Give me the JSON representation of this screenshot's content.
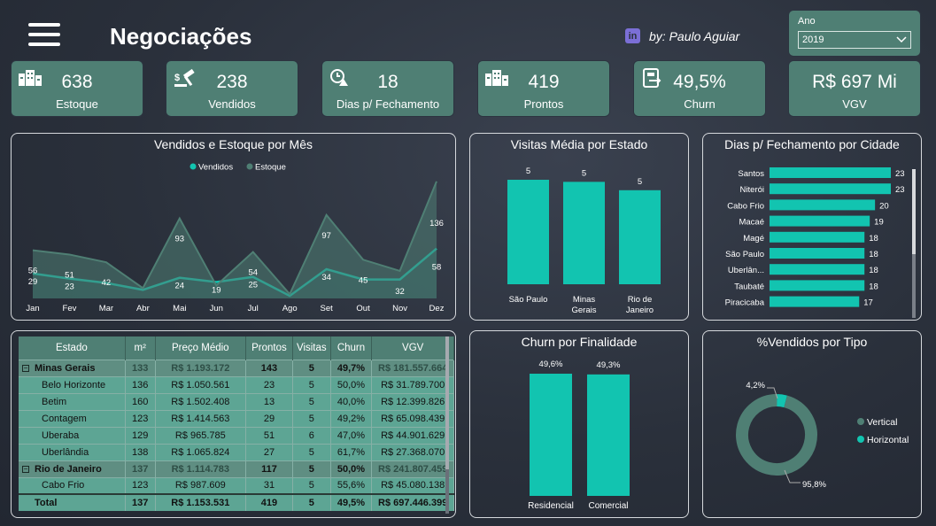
{
  "header": {
    "title": "Negociações",
    "author": "by: Paulo Aguiar",
    "linkedin_icon": "linkedin-icon",
    "filter_label": "Ano",
    "filter_value": "2019"
  },
  "colors": {
    "accent": "#12c4b0",
    "card": "#4f7f74",
    "estoque": "#4f7f74",
    "background": "#2a303b"
  },
  "kpis": [
    {
      "icon": "buildings-icon",
      "value": "638",
      "label": "Estoque"
    },
    {
      "icon": "auction-icon",
      "value": "238",
      "label": "Vendidos"
    },
    {
      "icon": "timer-icon",
      "value": "18",
      "label": "Dias p/ Fechamento"
    },
    {
      "icon": "buildings-icon",
      "value": "419",
      "label": "Prontos"
    },
    {
      "icon": "document-exit-icon",
      "value": "49,5%",
      "label": "Churn"
    },
    {
      "icon": "",
      "value": "R$ 697 Mi",
      "label": "VGV"
    }
  ],
  "chart_data": [
    {
      "type": "area",
      "title": "Vendidos e Estoque por Mês",
      "categories": [
        "Jan",
        "Fev",
        "Mar",
        "Abr",
        "Mai",
        "Jun",
        "Jul",
        "Ago",
        "Set",
        "Out",
        "Nov",
        "Dez"
      ],
      "series": [
        {
          "name": "Vendidos",
          "values": [
            29,
            23,
            18,
            10,
            24,
            19,
            25,
            3,
            34,
            22,
            22,
            58
          ],
          "labels": [
            "29",
            "23",
            "",
            "",
            "24",
            "19",
            "25",
            "",
            "34",
            "",
            "",
            "58"
          ]
        },
        {
          "name": "Estoque",
          "values": [
            56,
            51,
            42,
            12,
            93,
            15,
            54,
            5,
            97,
            45,
            32,
            136
          ],
          "labels": [
            "56",
            "51",
            "42",
            "",
            "93",
            "",
            "54",
            "",
            "97",
            "45",
            "32",
            "136"
          ]
        }
      ],
      "legend": "top-center"
    },
    {
      "type": "bar",
      "title": "Visitas Média por Estado",
      "categories": [
        "São Paulo",
        "Minas Gerais",
        "Rio de Janeiro"
      ],
      "values": [
        5.0,
        4.9,
        4.5
      ],
      "labels": [
        "5",
        "5",
        "5"
      ]
    },
    {
      "type": "bar",
      "orientation": "horizontal",
      "title": "Dias p/ Fechamento por Cidade",
      "categories": [
        "Santos",
        "Niterói",
        "Cabo Frio",
        "Macaé",
        "Magé",
        "São Paulo",
        "Uberlân...",
        "Taubaté",
        "Piracicaba"
      ],
      "values": [
        23,
        23,
        20,
        19,
        18,
        18,
        18,
        18,
        17
      ]
    },
    {
      "type": "bar",
      "title": "Churn por Finalidade",
      "categories": [
        "Residencial",
        "Comercial"
      ],
      "values": [
        49.6,
        49.3
      ],
      "labels": [
        "49,6%",
        "49,3%"
      ]
    },
    {
      "type": "pie",
      "title": "%Vendidos por Tipo",
      "series": [
        {
          "name": "Vertical",
          "value": 95.8,
          "label": "95,8%"
        },
        {
          "name": "Horizontal",
          "value": 4.2,
          "label": "4,2%"
        }
      ],
      "legend": "right"
    }
  ],
  "table": {
    "columns": [
      "Estado",
      "m²",
      "Preço Médio",
      "Prontos",
      "Visitas",
      "Churn",
      "VGV"
    ],
    "rows": [
      {
        "type": "group",
        "cells": [
          "Minas Gerais",
          "133",
          "R$ 1.193.172",
          "143",
          "5",
          "49,7%",
          "R$ 181.557.664"
        ]
      },
      {
        "type": "row",
        "cells": [
          "Belo Horizonte",
          "136",
          "R$ 1.050.561",
          "23",
          "5",
          "50,0%",
          "R$ 31.789.700"
        ]
      },
      {
        "type": "row",
        "cells": [
          "Betim",
          "160",
          "R$ 1.502.408",
          "13",
          "5",
          "40,0%",
          "R$ 12.399.826"
        ]
      },
      {
        "type": "row",
        "cells": [
          "Contagem",
          "123",
          "R$ 1.414.563",
          "29",
          "5",
          "49,2%",
          "R$ 65.098.439"
        ]
      },
      {
        "type": "row",
        "cells": [
          "Uberaba",
          "129",
          "R$ 965.785",
          "51",
          "6",
          "47,0%",
          "R$ 44.901.629"
        ]
      },
      {
        "type": "row",
        "cells": [
          "Uberlândia",
          "138",
          "R$ 1.065.824",
          "27",
          "5",
          "61,7%",
          "R$ 27.368.070"
        ]
      },
      {
        "type": "group",
        "cells": [
          "Rio de Janeiro",
          "137",
          "R$ 1.114.783",
          "117",
          "5",
          "50,0%",
          "R$ 241.807.459"
        ]
      },
      {
        "type": "row",
        "cells": [
          "Cabo Frio",
          "123",
          "R$ 987.609",
          "31",
          "5",
          "55,6%",
          "R$ 45.080.138"
        ]
      }
    ],
    "total": [
      "Total",
      "137",
      "R$ 1.153.531",
      "419",
      "5",
      "49,5%",
      "R$ 697.446.399"
    ]
  }
}
